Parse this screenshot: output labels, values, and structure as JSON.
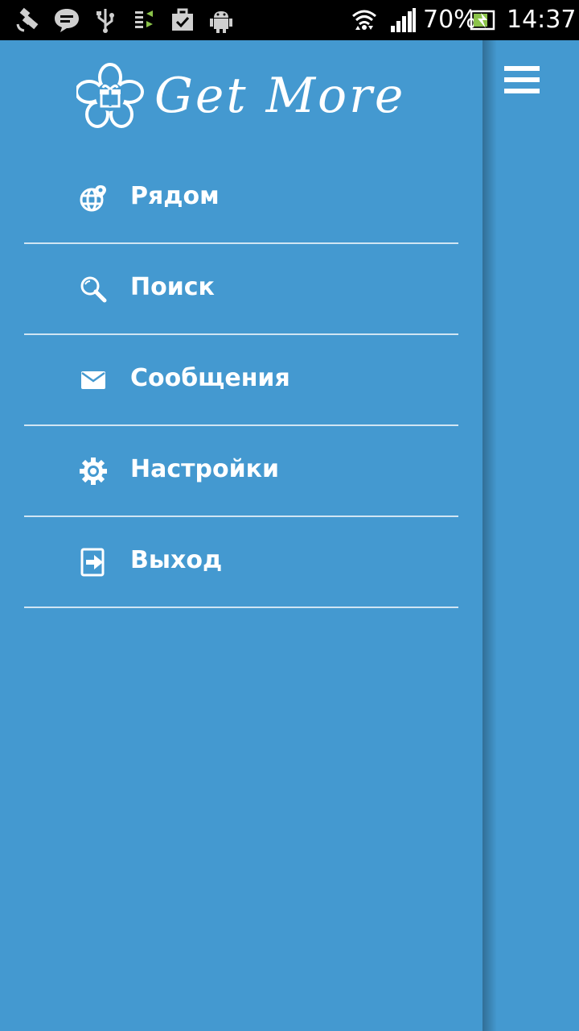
{
  "status_bar": {
    "battery_percent": "70%",
    "time": "14:37",
    "icons": [
      "satellite-icon",
      "chat-icon",
      "usb-icon",
      "data-sync-icon",
      "briefcase-check-icon",
      "android-icon",
      "wifi-icon",
      "signal-icon",
      "battery-charging-icon"
    ]
  },
  "app": {
    "logo_text": "Get More",
    "accent_color": "#4499d0"
  },
  "menu": {
    "items": [
      {
        "label": "Рядом",
        "icon": "globe-pin-icon"
      },
      {
        "label": "Поиск",
        "icon": "search-icon"
      },
      {
        "label": "Сообщения",
        "icon": "mail-icon"
      },
      {
        "label": "Настройки",
        "icon": "gear-icon"
      },
      {
        "label": "Выход",
        "icon": "exit-icon"
      }
    ]
  },
  "toolbar": {
    "menu_icon": "hamburger-menu-icon"
  }
}
